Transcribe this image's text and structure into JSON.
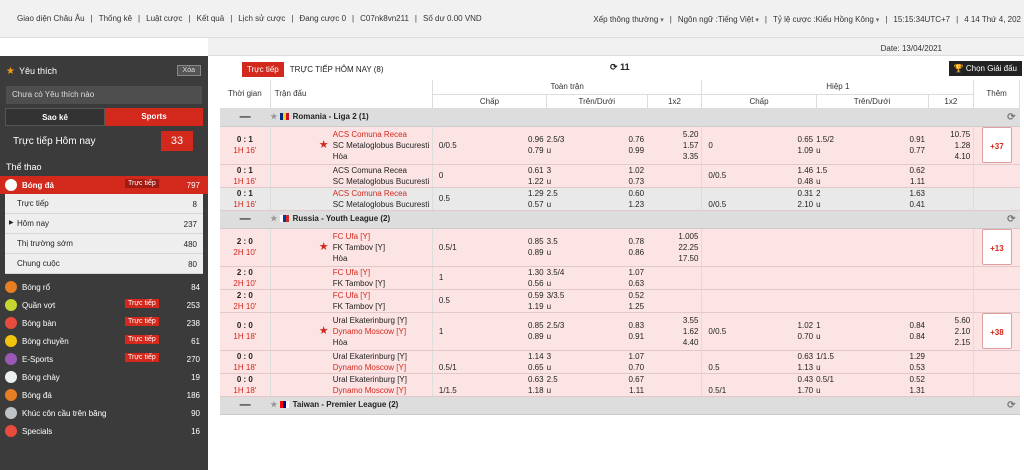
{
  "topbar": {
    "left": [
      "Giao diện Châu Âu",
      "Thống kê",
      "Luật cược",
      "Kết quả",
      "Lịch sử cược",
      "Đang cược 0",
      "C07nk8vn211",
      "Số dư 0.00 VND"
    ],
    "sort": "Xếp thông thường",
    "lang": "Ngôn ngữ :Tiếng Việt",
    "odds": "Tỷ lệ cược :Kiểu Hồng Kông",
    "time": "15:15:34UTC+7",
    "date_short": "4 14 Thứ 4, 202"
  },
  "datebar": {
    "date": "Date: 13/04/2021"
  },
  "sidebar": {
    "fav_title": "Yêu thích",
    "fav_btn": "Xóa",
    "fav_empty": "Chưa có Yêu thích nào",
    "tab_early": "Sao kê",
    "tab_sports": "Sports",
    "live_today": "Trực tiếp Hôm nay",
    "live_count": "33",
    "section": "Thể thao",
    "football": {
      "name": "Bóng đá",
      "live": "Trực tiếp",
      "n": "797"
    },
    "subs": [
      {
        "name": "Trực tiếp",
        "n": "8"
      },
      {
        "name": "Hôm nay",
        "n": "237"
      },
      {
        "name": "Thị trường sớm",
        "n": "480"
      },
      {
        "name": "Chung cuộc",
        "n": "80"
      }
    ],
    "sports": [
      {
        "name": "Bóng rổ",
        "live": "",
        "n": "84",
        "color": "#e67e22"
      },
      {
        "name": "Quần vợt",
        "live": "Trực tiếp",
        "n": "253",
        "color": "#c5d631"
      },
      {
        "name": "Bóng bàn",
        "live": "Trực tiếp",
        "n": "238",
        "color": "#e74c3c"
      },
      {
        "name": "Bóng chuyền",
        "live": "Trực tiếp",
        "n": "61",
        "color": "#f1c40f"
      },
      {
        "name": "E-Sports",
        "live": "Trực tiếp",
        "n": "270",
        "color": "#9b59b6"
      },
      {
        "name": "Bóng chày",
        "live": "",
        "n": "19",
        "color": "#ecf0f1"
      },
      {
        "name": "Bóng đá",
        "live": "",
        "n": "186",
        "color": "#e67e22"
      },
      {
        "name": "Khúc côn cầu trên băng",
        "live": "",
        "n": "90",
        "color": "#bdc3c7"
      },
      {
        "name": "Specials",
        "live": "",
        "n": "16",
        "color": "#e74c3c"
      }
    ]
  },
  "main": {
    "live_label": "Trực tiếp",
    "title": "TRỰC TIẾP HÔM NAY (8)",
    "refresh_count": "11",
    "choose_league": "Chọn Giải đấu",
    "cols": {
      "time": "Thời gian",
      "match": "Trận đấu",
      "ft": "Toàn trận",
      "h1": "Hiệp 1",
      "more": "Thêm",
      "hdp": "Chấp",
      "ou": "Trên/Dưới",
      "x12": "1x2"
    },
    "leagues": [
      {
        "name": "Romania - Liga 2 (1)",
        "flag": [
          "#002b7f",
          "#fcd116",
          "#ce1126"
        ],
        "matches": [
          {
            "score": "0 : 1",
            "time": "1H 16'",
            "h": "ACS Comuna Recea",
            "a": "SC Metaloglobus Bucuresti",
            "draw": "Hòa",
            "hred": true,
            "ared": false,
            "star": true,
            "bg": "pink",
            "hdp": [
              "0/0.5",
              ""
            ],
            "hdp_o": [
              "0.96",
              "0.79"
            ],
            "ou": [
              "2.5/3",
              "u"
            ],
            "ou_o": [
              "0.76",
              "0.99"
            ],
            "x": [
              "5.20",
              "1.57",
              "3.35"
            ],
            "hdp1": [
              "0",
              ""
            ],
            "hdp1_o": [
              "0.65",
              "1.09"
            ],
            "ou1": [
              "1.5/2",
              "u"
            ],
            "ou1_o": [
              "0.91",
              "0.77"
            ],
            "x1": [
              "10.75",
              "1.28",
              "4.10"
            ],
            "more": "+37"
          },
          {
            "score": "0 : 1",
            "time": "1H 16'",
            "h": "ACS Comuna Recea",
            "a": "SC Metaloglobus Bucuresti",
            "draw": "",
            "hred": false,
            "ared": false,
            "star": false,
            "bg": "pink",
            "hdp": [
              "0",
              ""
            ],
            "hdp_o": [
              "0.61",
              "1.22"
            ],
            "ou": [
              "3",
              "u"
            ],
            "ou_o": [
              "1.02",
              "0.73"
            ],
            "x": [
              "",
              "",
              ""
            ],
            "hdp1": [
              "0/0.5",
              ""
            ],
            "hdp1_o": [
              "1.46",
              "0.48"
            ],
            "ou1": [
              "1.5",
              "u"
            ],
            "ou1_o": [
              "0.62",
              "1.11"
            ],
            "x1": [
              "",
              "",
              ""
            ],
            "more": ""
          },
          {
            "score": "0 : 1",
            "time": "1H 16'",
            "h": "ACS Comuna Recea",
            "a": "SC Metaloglobus Bucuresti",
            "draw": "",
            "hred": true,
            "ared": false,
            "star": false,
            "bg": "grey",
            "hdp": [
              "0.5",
              ""
            ],
            "hdp_o": [
              "1.29",
              "0.57"
            ],
            "ou": [
              "2.5",
              "u"
            ],
            "ou_o": [
              "0.60",
              "1.23"
            ],
            "x": [
              "",
              "",
              ""
            ],
            "hdp1": [
              "",
              "0/0.5"
            ],
            "hdp1_o": [
              "0.31",
              "2.10"
            ],
            "ou1": [
              "2",
              "u"
            ],
            "ou1_o": [
              "1.63",
              "0.41"
            ],
            "x1": [
              "",
              "",
              ""
            ],
            "more": ""
          }
        ]
      },
      {
        "name": "Russia - Youth League (2)",
        "flag": [
          "#ffffff",
          "#0039a6",
          "#d52b1e"
        ],
        "matches": [
          {
            "score": "2 : 0",
            "time": "2H 10'",
            "h": "FC Ufa [Y]",
            "a": "FK Tambov [Y]",
            "draw": "Hòa",
            "hred": true,
            "ared": false,
            "star": true,
            "bg": "pink",
            "hdp": [
              "0.5/1",
              ""
            ],
            "hdp_o": [
              "0.85",
              "0.89"
            ],
            "ou": [
              "3.5",
              "u"
            ],
            "ou_o": [
              "0.78",
              "0.86"
            ],
            "x": [
              "1.005",
              "22.25",
              "17.50"
            ],
            "hdp1": [
              "",
              ""
            ],
            "hdp1_o": [
              "",
              ""
            ],
            "ou1": [
              "",
              ""
            ],
            "ou1_o": [
              "",
              ""
            ],
            "x1": [
              "",
              "",
              ""
            ],
            "more": "+13"
          },
          {
            "score": "2 : 0",
            "time": "2H 10'",
            "h": "FC Ufa [Y]",
            "a": "FK Tambov [Y]",
            "draw": "",
            "hred": true,
            "ared": false,
            "star": false,
            "bg": "pink",
            "hdp": [
              "1",
              ""
            ],
            "hdp_o": [
              "1.30",
              "0.56"
            ],
            "ou": [
              "3.5/4",
              "u"
            ],
            "ou_o": [
              "1.07",
              "0.63"
            ],
            "x": [
              "",
              "",
              ""
            ],
            "hdp1": [
              "",
              ""
            ],
            "hdp1_o": [
              "",
              ""
            ],
            "ou1": [
              "",
              ""
            ],
            "ou1_o": [
              "",
              ""
            ],
            "x1": [
              "",
              "",
              ""
            ],
            "more": ""
          },
          {
            "score": "2 : 0",
            "time": "2H 10'",
            "h": "FC Ufa [Y]",
            "a": "FK Tambov [Y]",
            "draw": "",
            "hred": true,
            "ared": false,
            "star": false,
            "bg": "pink",
            "hdp": [
              "0.5",
              ""
            ],
            "hdp_o": [
              "0.59",
              "1.19"
            ],
            "ou": [
              "3/3.5",
              "u"
            ],
            "ou_o": [
              "0.52",
              "1.25"
            ],
            "x": [
              "",
              "",
              ""
            ],
            "hdp1": [
              "",
              ""
            ],
            "hdp1_o": [
              "",
              ""
            ],
            "ou1": [
              "",
              ""
            ],
            "ou1_o": [
              "",
              ""
            ],
            "x1": [
              "",
              "",
              ""
            ],
            "more": ""
          },
          {
            "score": "0 : 0",
            "time": "1H 18'",
            "h": "Ural Ekaterinburg [Y]",
            "a": "Dynamo Moscow [Y]",
            "draw": "Hòa",
            "hred": false,
            "ared": true,
            "star": true,
            "bg": "pink",
            "hdp": [
              "1",
              ""
            ],
            "hdp_o": [
              "0.85",
              "0.89"
            ],
            "ou": [
              "2.5/3",
              "u"
            ],
            "ou_o": [
              "0.83",
              "0.91"
            ],
            "x": [
              "3.55",
              "1.62",
              "4.40"
            ],
            "hdp1": [
              "0/0.5",
              ""
            ],
            "hdp1_o": [
              "1.02",
              "0.70"
            ],
            "ou1": [
              "1",
              "u"
            ],
            "ou1_o": [
              "0.84",
              "0.84"
            ],
            "x1": [
              "5.60",
              "2.10",
              "2.15"
            ],
            "more": "+38"
          },
          {
            "score": "0 : 0",
            "time": "1H 18'",
            "h": "Ural Ekaterinburg [Y]",
            "a": "Dynamo Moscow [Y]",
            "draw": "",
            "hred": false,
            "ared": true,
            "star": false,
            "bg": "pink",
            "hdp": [
              "",
              "0.5/1"
            ],
            "hdp_o": [
              "1.14",
              "0.65"
            ],
            "ou": [
              "3",
              "u"
            ],
            "ou_o": [
              "1.07",
              "0.70"
            ],
            "x": [
              "",
              "",
              ""
            ],
            "hdp1": [
              "",
              "0.5"
            ],
            "hdp1_o": [
              "0.63",
              "1.13"
            ],
            "ou1": [
              "1/1.5",
              "u"
            ],
            "ou1_o": [
              "1.29",
              "0.53"
            ],
            "x1": [
              "",
              "",
              ""
            ],
            "more": ""
          },
          {
            "score": "0 : 0",
            "time": "1H 18'",
            "h": "Ural Ekaterinburg [Y]",
            "a": "Dynamo Moscow [Y]",
            "draw": "",
            "hred": false,
            "ared": true,
            "star": false,
            "bg": "pink",
            "hdp": [
              "",
              "1/1.5"
            ],
            "hdp_o": [
              "0.63",
              "1.18"
            ],
            "ou": [
              "2.5",
              "u"
            ],
            "ou_o": [
              "0.67",
              "1.11"
            ],
            "x": [
              "",
              "",
              ""
            ],
            "hdp1": [
              "",
              "0.5/1"
            ],
            "hdp1_o": [
              "0.43",
              "1.70"
            ],
            "ou1": [
              "0.5/1",
              "u"
            ],
            "ou1_o": [
              "0.52",
              "1.31"
            ],
            "x1": [
              "",
              "",
              ""
            ],
            "more": ""
          }
        ]
      },
      {
        "name": "Taiwan - Premier League (2)",
        "flag": [
          "#fe0000",
          "#000095",
          "#ffffff"
        ],
        "matches": []
      }
    ]
  }
}
